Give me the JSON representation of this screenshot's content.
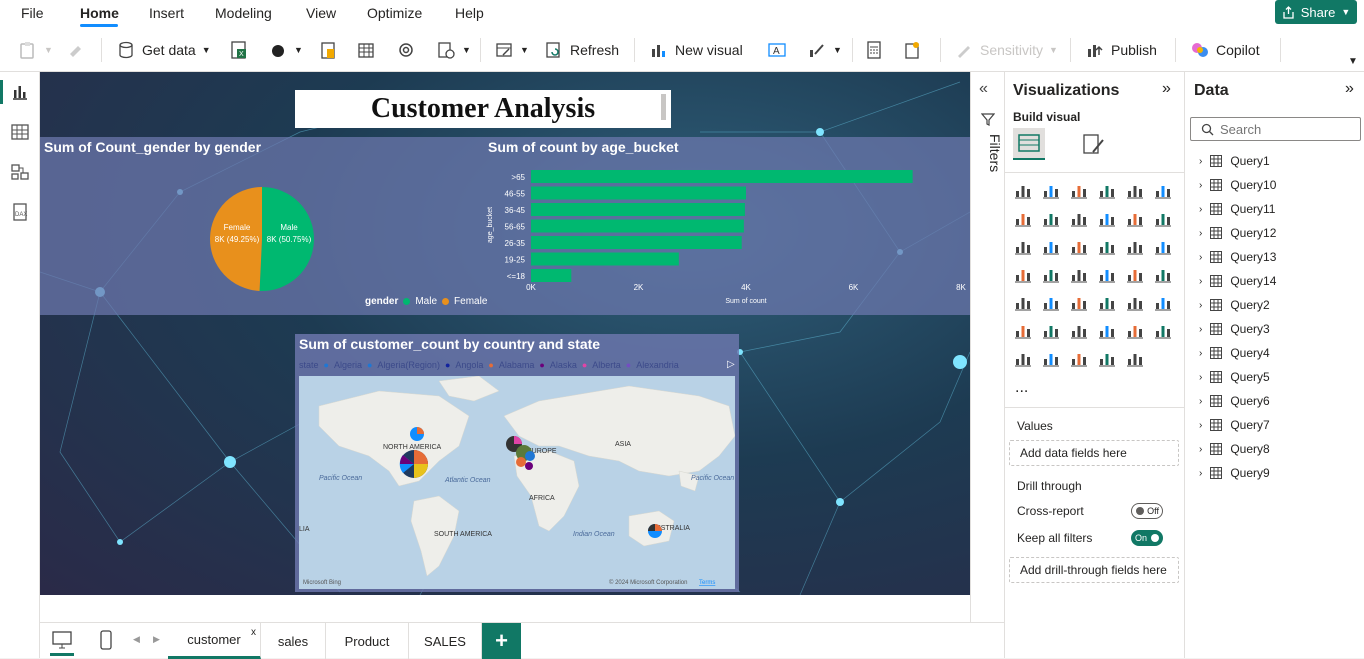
{
  "menu": {
    "items": [
      "File",
      "Home",
      "Insert",
      "Modeling",
      "View",
      "Optimize",
      "Help"
    ],
    "active": "Home",
    "share": "Share"
  },
  "ribbon": {
    "get_data": "Get data",
    "refresh": "Refresh",
    "new_visual": "New visual",
    "sensitivity": "Sensitivity",
    "publish": "Publish",
    "copilot": "Copilot"
  },
  "report": {
    "title": "Customer Analysis",
    "gender_chart": {
      "title": "Sum of Count_gender by gender",
      "legend_title": "gender",
      "legend": [
        "Male",
        "Female"
      ],
      "labels": {
        "female": "Female",
        "female_val": "8K (49.25%)",
        "male": "Male",
        "male_val": "8K (50.75%)"
      }
    },
    "age_chart": {
      "title": "Sum of count by age_bucket",
      "ylabel": "age_bucket",
      "xlabel": "Sum of count",
      "ticks": [
        "0K",
        "2K",
        "4K",
        "6K",
        "8K"
      ]
    },
    "map_chart": {
      "title": "Sum of customer_count by country and state",
      "legend_prefix": "state",
      "legend": [
        "Algeria",
        "Algeria(Region)",
        "Angola",
        "Alabama",
        "Alaska",
        "Alberta",
        "Alexandria"
      ],
      "labels": {
        "na": "NORTH AMERICA",
        "sa": "SOUTH AMERICA",
        "eu": "EUROPE",
        "af": "AFRICA",
        "as": "ASIA",
        "au": "AUSTRALIA",
        "pac1": "Pacific Ocean",
        "pac2": "Pacific Ocean",
        "atl": "Atlantic Ocean",
        "ind": "Indian Ocean",
        "lia": "LIA",
        "bing": "Microsoft Bing",
        "copyright": "© 2024 Microsoft Corporation",
        "terms": "Terms"
      }
    }
  },
  "chart_data": [
    {
      "type": "pie",
      "title": "Sum of Count_gender by gender",
      "categories": [
        "Male",
        "Female"
      ],
      "values": [
        50.75,
        49.25
      ],
      "legend_title": "gender",
      "colors": {
        "Male": "#00b870",
        "Female": "#e8901c"
      }
    },
    {
      "type": "bar",
      "title": "Sum of count by age_bucket",
      "xlabel": "Sum of count",
      "ylabel": "age_bucket",
      "categories": [
        ">65",
        "46-55",
        "36-45",
        "56-65",
        "26-35",
        "19-25",
        "<=18"
      ],
      "values": [
        7100,
        4000,
        3980,
        3960,
        3920,
        2750,
        750
      ],
      "xlim": [
        0,
        8000
      ],
      "color": "#00b870"
    }
  ],
  "filters": {
    "label": "Filters"
  },
  "viz": {
    "title": "Visualizations",
    "build": "Build visual",
    "values_label": "Values",
    "add_fields": "Add data fields here",
    "drill": "Drill through",
    "cross": "Cross-report",
    "cross_state": "Off",
    "keep": "Keep all filters",
    "keep_state": "On",
    "add_drill": "Add drill-through fields here",
    "more": "..."
  },
  "data": {
    "title": "Data",
    "search_placeholder": "Search",
    "queries": [
      "Query1",
      "Query10",
      "Query11",
      "Query12",
      "Query13",
      "Query14",
      "Query2",
      "Query3",
      "Query4",
      "Query5",
      "Query6",
      "Query7",
      "Query8",
      "Query9"
    ]
  },
  "tabs": {
    "pages": [
      "customer",
      "sales",
      "Product",
      "SALES"
    ],
    "active": "customer",
    "close": "x",
    "add": "+"
  },
  "colors": {
    "accent": "#117865",
    "green": "#00b870",
    "orange": "#e8901c"
  }
}
